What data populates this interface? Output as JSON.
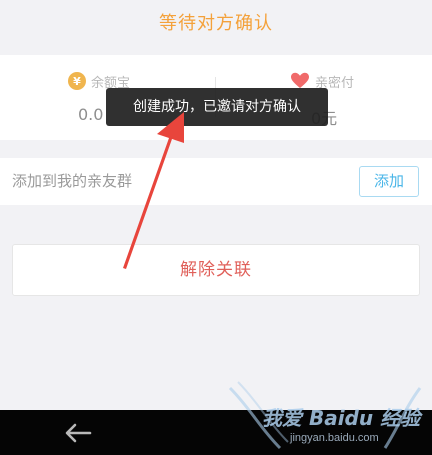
{
  "header": {
    "title": "等待对方确认"
  },
  "balances": {
    "left": {
      "label": "余额宝",
      "amount": "0.0",
      "icon": "coin-icon",
      "icon_color": "#f0b54e"
    },
    "right": {
      "label": "亲密付",
      "amount": "0元",
      "icon": "heart-icon",
      "icon_color": "#f06a6a"
    }
  },
  "toast": {
    "message": "创建成功，已邀请对方确认"
  },
  "group": {
    "label": "添加到我的亲友群",
    "add_label": "添加"
  },
  "actions": {
    "unlink_label": "解除关联"
  },
  "annotation": {
    "arrow_color": "#e8453c"
  },
  "navbar": {
    "back_icon": "back-arrow-icon"
  },
  "watermark": {
    "main": "我爱 Baidu 经验",
    "sub": "jingyan.baidu.com"
  },
  "colors": {
    "title": "#f4a13a",
    "accent_blue": "#4ab6e8",
    "danger": "#e0605a",
    "background": "#f2f2f5"
  }
}
